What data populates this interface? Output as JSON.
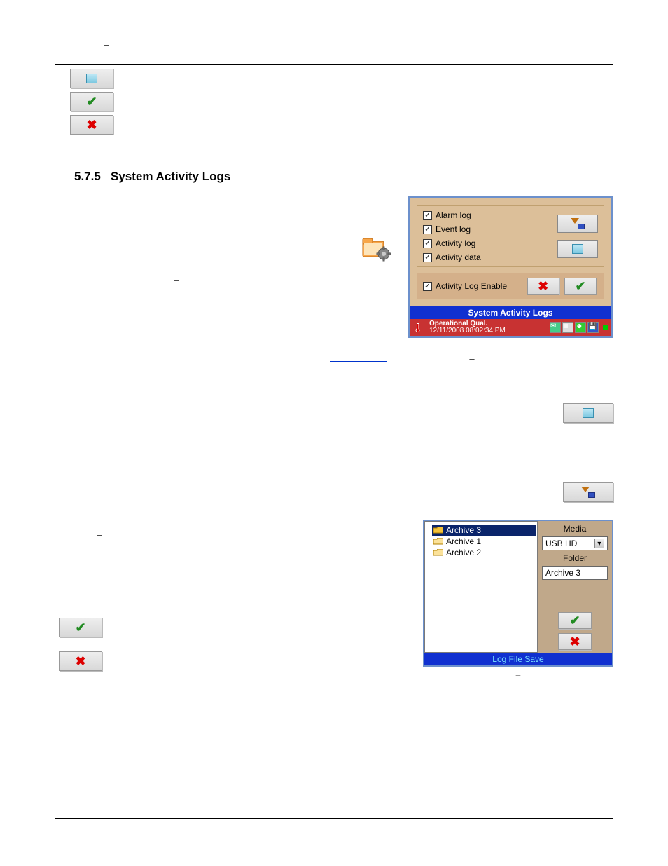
{
  "top_dash": "–",
  "dash_a": "–",
  "dash_b": "–",
  "link_dash": "–",
  "dash_c": "–",
  "section_number": "5.7.5",
  "section_title": "System Activity Logs",
  "shot1": {
    "checks": {
      "alarm": {
        "label": "Alarm log",
        "checked": true
      },
      "event": {
        "label": "Event log",
        "checked": true
      },
      "activity": {
        "label": "Activity log",
        "checked": true
      },
      "data": {
        "label": "Activity data",
        "checked": true
      }
    },
    "enable": {
      "label": "Activity Log Enable",
      "checked": true
    },
    "title": "System Activity Logs",
    "status_line1": "Operational Qual.",
    "status_line2": "12/11/2008 08:02:34 PM"
  },
  "shot2": {
    "tree": [
      "Archive 3",
      "Archive 1",
      "Archive 2"
    ],
    "selected_index": 0,
    "media_label": "Media",
    "media_value": "USB HD",
    "folder_label": "Folder",
    "folder_value": "Archive 3",
    "title": "Log File Save"
  },
  "captions": {
    "shot1": "–",
    "shot2": "–"
  }
}
